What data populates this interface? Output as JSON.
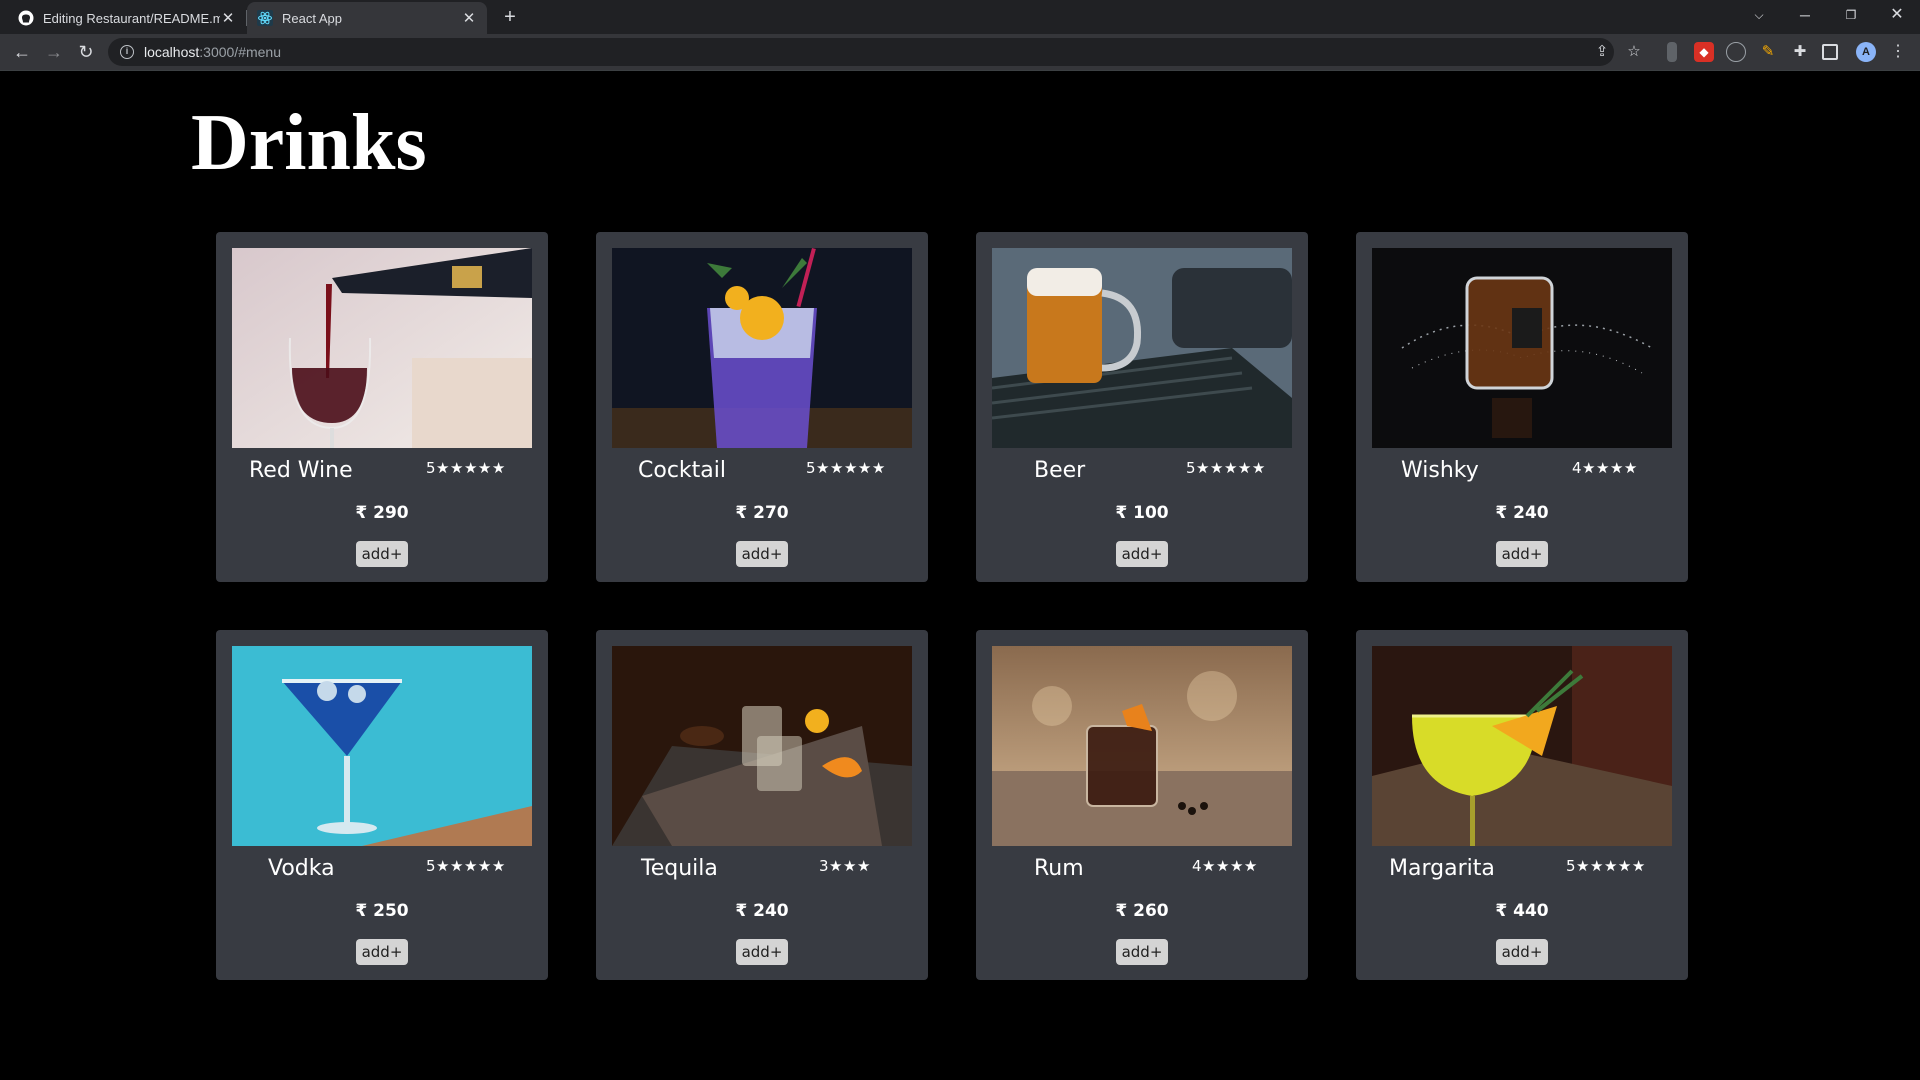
{
  "browser": {
    "tabs": [
      {
        "title": "Editing Restaurant/README.md at",
        "favicon": "github-icon"
      },
      {
        "title": "React App",
        "favicon": "react-icon"
      }
    ],
    "url_host": "localhost",
    "url_rest": ":3000/#menu"
  },
  "page": {
    "heading": "Drinks",
    "items": [
      {
        "name": "Red Wine",
        "rating": "5★★★★★",
        "price": "₹ 290",
        "button": "add+"
      },
      {
        "name": "Cocktail",
        "rating": "5★★★★★",
        "price": "₹ 270",
        "button": "add+"
      },
      {
        "name": "Beer",
        "rating": "5★★★★★",
        "price": "₹ 100",
        "button": "add+"
      },
      {
        "name": "Wishky",
        "rating": "4★★★★",
        "price": "₹ 240",
        "button": "add+"
      },
      {
        "name": "Vodka",
        "rating": "5★★★★★",
        "price": "₹ 250",
        "button": "add+"
      },
      {
        "name": "Tequila",
        "rating": "3★★★",
        "price": "₹ 240",
        "button": "add+"
      },
      {
        "name": "Rum",
        "rating": "4★★★★",
        "price": "₹ 260",
        "button": "add+"
      },
      {
        "name": "Margarita",
        "rating": "5★★★★★",
        "price": "₹ 440",
        "button": "add+"
      }
    ]
  }
}
